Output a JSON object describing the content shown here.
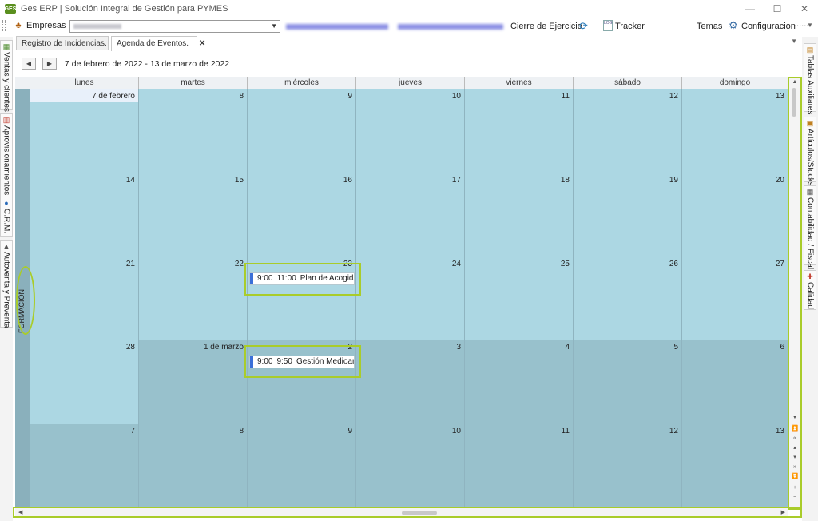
{
  "window": {
    "title": "Ges ERP | Solución Integral de Gestión para PYMES",
    "app_icon_text": "GES",
    "minimize": "—",
    "maximize": "☐",
    "close": "✕"
  },
  "toolbar": {
    "empresas_label": "Empresas",
    "cierre_label": "Cierre de Ejercicio",
    "tracker_label": "Tracker",
    "temas_label": "Temas",
    "config_label": "Configuracion",
    "more_label": "......"
  },
  "left_tabs": [
    "Ventas y clientes",
    "Aprovisionamientos",
    "C.R.M.",
    "Autoventa y Preventa"
  ],
  "right_tabs": [
    "Tablas Auxiliares",
    "Artículos/Stocks",
    "Contabilidad / Fiscal",
    "Calidad"
  ],
  "doc_tabs": [
    {
      "label": "Registro de Incidencias."
    },
    {
      "label": "Agenda de Eventos."
    }
  ],
  "nav": {
    "prev": "◀",
    "next": "▶",
    "date_range": "7 de febrero de 2022 - 13 de marzo de 2022"
  },
  "calendar": {
    "resource": "FORMACION",
    "weekdays": [
      "lunes",
      "martes",
      "miércoles",
      "jueves",
      "viernes",
      "sábado",
      "domingo"
    ],
    "weeks": [
      [
        "7 de febrero",
        "8",
        "9",
        "10",
        "11",
        "12",
        "13"
      ],
      [
        "14",
        "15",
        "16",
        "17",
        "18",
        "19",
        "20"
      ],
      [
        "21",
        "22",
        "23",
        "24",
        "25",
        "26",
        "27"
      ],
      [
        "28",
        "1 de marzo",
        "2",
        "3",
        "4",
        "5",
        "6"
      ],
      [
        "7",
        "8",
        "9",
        "10",
        "11",
        "12",
        "13"
      ]
    ],
    "events": [
      {
        "week": 2,
        "day": 2,
        "start": "9:00",
        "end": "11:00",
        "title": "Plan de Acogida"
      },
      {
        "week": 3,
        "day": 2,
        "start": "9:00",
        "end": "9:50",
        "title": "Gestión Medioamb..."
      }
    ]
  },
  "colors": {
    "accent_highlight": "#a9cc2a",
    "event_bar": "#3a6fd8",
    "current_month_cell": "#acd7e3",
    "other_month_cell": "#98c1cc"
  }
}
